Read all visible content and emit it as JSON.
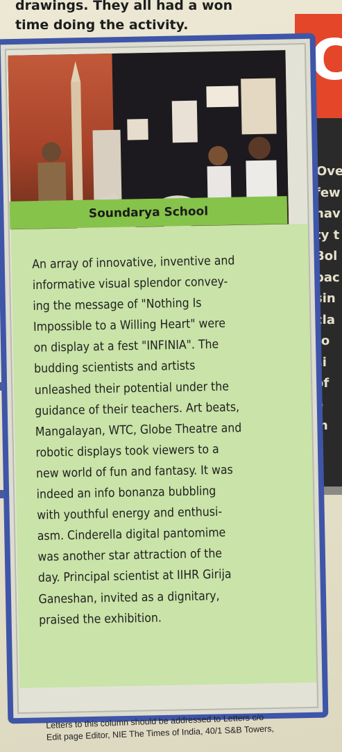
{
  "top_text": {
    "lines": [
      "drawings. They all had a won",
      "time doing the activity."
    ]
  },
  "right_column": {
    "banner_letter": "C",
    "words": [
      "Over",
      "few",
      "hav",
      "ty t",
      "Bol",
      "bac",
      "sin",
      "cla",
      "ro",
      "si",
      "of",
      "e",
      "m",
      "d"
    ]
  },
  "article": {
    "photo_label": "school exhibition photo",
    "caption": "Soundarya School",
    "body_lines": [
      "An array of innovative, inventive and",
      "informative visual splendor convey-",
      "ing the message of \"Nothing Is",
      "Impossible to a Willing Heart\" were",
      "on display at a fest \"INFINIA\". The",
      "budding scientists and artists",
      "unleashed their potential under the",
      "guidance of their teachers. Art beats,",
      "Mangalayan, WTC, Globe Theatre and",
      "robotic displays took viewers to a",
      "new world of fun and fantasy. It was",
      "indeed an info bonanza bubbling",
      "with youthful energy and enthusi-",
      "asm. Cinderella digital pantomime",
      "was another star attraction of the",
      "day. Principal scientist at IIHR Girija",
      "Ganeshan, invited as a dignitary,",
      "praised the exhibition."
    ]
  },
  "footer": {
    "lines": [
      "Letters to this column should be addressed to Letters c/o",
      "Edit page Editor, NIE The Times of India, 40/1 S&B Towers,"
    ]
  },
  "colors": {
    "frame_blue": "#3e55a8",
    "caption_green": "#86c34a",
    "panel_green": "#c9e3a8",
    "banner_red": "#e4462a"
  }
}
